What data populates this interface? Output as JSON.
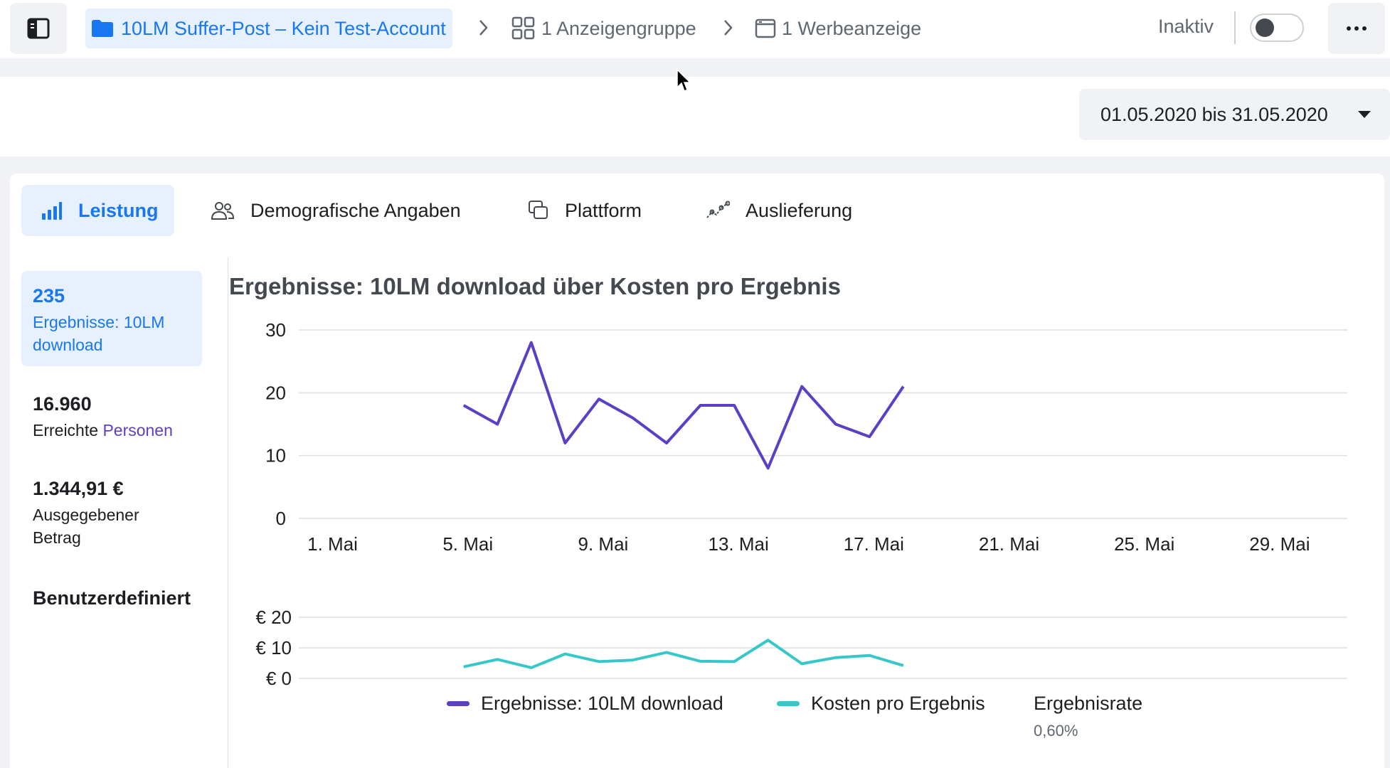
{
  "breadcrumb": {
    "campaign": "10LM Suffer-Post – Kein Test-Account",
    "adset": "1 Anzeigengruppe",
    "ad": "1 Werbeanzeige"
  },
  "status": {
    "label": "Inaktiv",
    "toggle_on": false
  },
  "date_range": "01.05.2020 bis 31.05.2020",
  "tabs": [
    {
      "label": "Leistung",
      "icon": "bar-chart-icon",
      "active": true
    },
    {
      "label": "Demografische Angaben",
      "icon": "people-icon",
      "active": false
    },
    {
      "label": "Plattform",
      "icon": "platform-icon",
      "active": false
    },
    {
      "label": "Auslieferung",
      "icon": "delivery-icon",
      "active": false
    }
  ],
  "metrics": [
    {
      "value": "235",
      "label_lines": [
        "Ergebnisse: 10LM",
        "download"
      ],
      "active": true
    },
    {
      "value": "16.960",
      "label_prefix": "Erreichte ",
      "label_link": "Personen"
    },
    {
      "value": "1.344,91 €",
      "label_lines": [
        "Ausgegebener",
        "Betrag"
      ]
    },
    {
      "value": "Benutzerdefiniert"
    }
  ],
  "colors": {
    "accent": "#1877f2",
    "results_series": "#5b3fc6",
    "cost_series": "#36c8c8",
    "link": "#5b3fc6"
  },
  "chart_data": [
    {
      "type": "line",
      "title": "Ergebnisse: 10LM download über Kosten pro Ergebnis",
      "x_tick_labels": [
        "1. Mai",
        "5. Mai",
        "9. Mai",
        "13. Mai",
        "17. Mai",
        "21. Mai",
        "25. Mai",
        "29. Mai"
      ],
      "x_ticks_day": [
        1,
        5,
        9,
        13,
        17,
        21,
        25,
        29
      ],
      "x_range_day": [
        0,
        31
      ],
      "y_ticks": [
        0,
        10,
        20,
        30
      ],
      "ylim": [
        0,
        30
      ],
      "grid": true,
      "series": [
        {
          "name": "Ergebnisse: 10LM download",
          "x_day": [
            5,
            6,
            7,
            8,
            9,
            10,
            11,
            12,
            13,
            14,
            15,
            16,
            17,
            18
          ],
          "values": [
            18,
            15,
            28,
            12,
            19,
            16,
            12,
            18,
            18,
            8,
            21,
            15,
            13,
            21
          ]
        }
      ]
    },
    {
      "type": "line",
      "y_tick_labels": [
        "€ 0",
        "€ 10",
        "€ 20"
      ],
      "y_ticks": [
        0,
        10,
        20
      ],
      "ylim": [
        0,
        20
      ],
      "grid": true,
      "series": [
        {
          "name": "Kosten pro Ergebnis",
          "x_day": [
            5,
            6,
            7,
            8,
            9,
            10,
            11,
            12,
            13,
            14,
            15,
            16,
            17,
            18
          ],
          "values": [
            3.8,
            6.2,
            3.5,
            8.0,
            5.5,
            6.0,
            8.5,
            5.6,
            5.5,
            12.5,
            4.8,
            6.8,
            7.5,
            4.2
          ]
        }
      ]
    }
  ],
  "legend": {
    "results": "Ergebnisse: 10LM download",
    "cost": "Kosten pro Ergebnis",
    "rate_label": "Ergebnisrate",
    "rate_value": "0,60%"
  }
}
